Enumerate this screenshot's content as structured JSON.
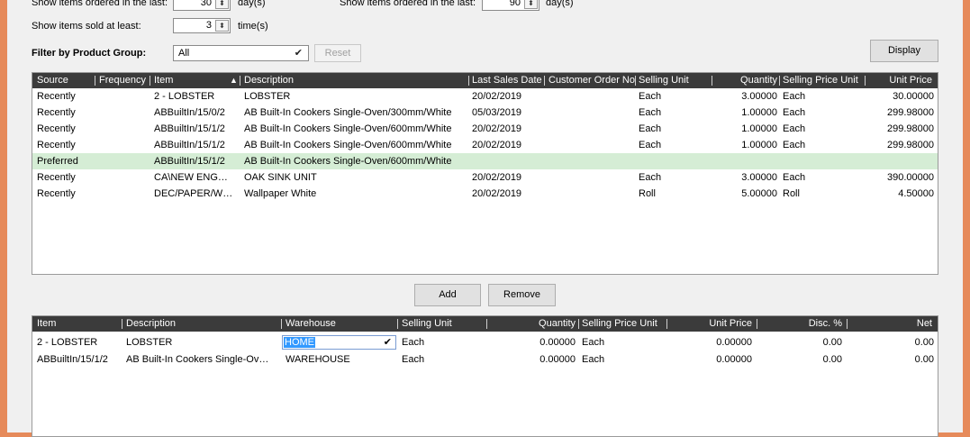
{
  "filters": {
    "ordered_last_label": "Show items ordered in the last:",
    "ordered_last_value": "30",
    "ordered_last_unit": "day(s)",
    "sold_at_least_label": "Show items sold at least:",
    "sold_at_least_value": "3",
    "sold_at_least_unit": "time(s)",
    "ordered_last2_label": "Show items ordered in the last:",
    "ordered_last2_value": "90",
    "ordered_last2_unit": "day(s)",
    "product_group_label": "Filter by Product Group:",
    "product_group_value": "All",
    "reset_label": "Reset",
    "display_label": "Display"
  },
  "top_grid": {
    "columns": [
      "Source",
      "Frequency",
      "Item",
      "Description",
      "Last Sales Date",
      "Customer Order No",
      "Selling Unit",
      "Quantity",
      "Selling Price Unit",
      "Unit Price"
    ],
    "sort_indicator": "▲",
    "rows": [
      {
        "source": "Recently",
        "frequency": "",
        "item": "2 - LOBSTER",
        "description": "LOBSTER",
        "last_sales_date": "20/02/2019",
        "customer_order_no": "",
        "selling_unit": "Each",
        "quantity": "3.00000",
        "selling_price_unit": "Each",
        "unit_price": "30.00000"
      },
      {
        "source": "Recently",
        "frequency": "",
        "item": "ABBuiltIn/15/0/2",
        "description": "AB Built-In Cookers Single-Oven/300mm/White",
        "last_sales_date": "05/03/2019",
        "customer_order_no": "",
        "selling_unit": "Each",
        "quantity": "1.00000",
        "selling_price_unit": "Each",
        "unit_price": "299.98000"
      },
      {
        "source": "Recently",
        "frequency": "",
        "item": "ABBuiltIn/15/1/2",
        "description": "AB Built-In Cookers Single-Oven/600mm/White",
        "last_sales_date": "20/02/2019",
        "customer_order_no": "",
        "selling_unit": "Each",
        "quantity": "1.00000",
        "selling_price_unit": "Each",
        "unit_price": "299.98000"
      },
      {
        "source": "Recently",
        "frequency": "",
        "item": "ABBuiltIn/15/1/2",
        "description": "AB Built-In Cookers Single-Oven/600mm/White",
        "last_sales_date": "20/02/2019",
        "customer_order_no": "",
        "selling_unit": "Each",
        "quantity": "1.00000",
        "selling_price_unit": "Each",
        "unit_price": "299.98000"
      },
      {
        "source": "Preferred",
        "frequency": "",
        "item": "ABBuiltIn/15/1/2",
        "description": "AB Built-In Cookers Single-Oven/600mm/White",
        "last_sales_date": "",
        "customer_order_no": "",
        "selling_unit": "",
        "quantity": "",
        "selling_price_unit": "",
        "unit_price": "",
        "selected": true
      },
      {
        "source": "Recently",
        "frequency": "",
        "item": "CA\\NEW ENG…",
        "description": "OAK SINK UNIT",
        "last_sales_date": "20/02/2019",
        "customer_order_no": "",
        "selling_unit": "Each",
        "quantity": "3.00000",
        "selling_price_unit": "Each",
        "unit_price": "390.00000"
      },
      {
        "source": "Recently",
        "frequency": "",
        "item": "DEC/PAPER/W…",
        "description": "Wallpaper White",
        "last_sales_date": "20/02/2019",
        "customer_order_no": "",
        "selling_unit": "Roll",
        "quantity": "5.00000",
        "selling_price_unit": "Roll",
        "unit_price": "4.50000"
      }
    ]
  },
  "actions": {
    "add_label": "Add",
    "remove_label": "Remove"
  },
  "bottom_grid": {
    "columns": [
      "Item",
      "Description",
      "Warehouse",
      "Selling Unit",
      "Quantity",
      "Selling Price Unit",
      "Unit Price",
      "Disc. %",
      "Net"
    ],
    "rows": [
      {
        "item": "2 - LOBSTER",
        "description": "LOBSTER",
        "warehouse": "HOME",
        "selling_unit": "Each",
        "quantity": "0.00000",
        "selling_price_unit": "Each",
        "unit_price": "0.00000",
        "disc": "0.00",
        "net": "0.00",
        "editing": true
      },
      {
        "item": "ABBuiltIn/15/1/2",
        "description": "AB Built-In Cookers Single-Ov…",
        "warehouse": "WAREHOUSE",
        "selling_unit": "Each",
        "quantity": "0.00000",
        "selling_price_unit": "Each",
        "unit_price": "0.00000",
        "disc": "0.00",
        "net": "0.00"
      }
    ]
  },
  "colors": {
    "window_border": "#e68a5a",
    "header_bg": "#3b3b3b",
    "selected_row": "#d5edd5",
    "highlight": "#3399ff"
  }
}
